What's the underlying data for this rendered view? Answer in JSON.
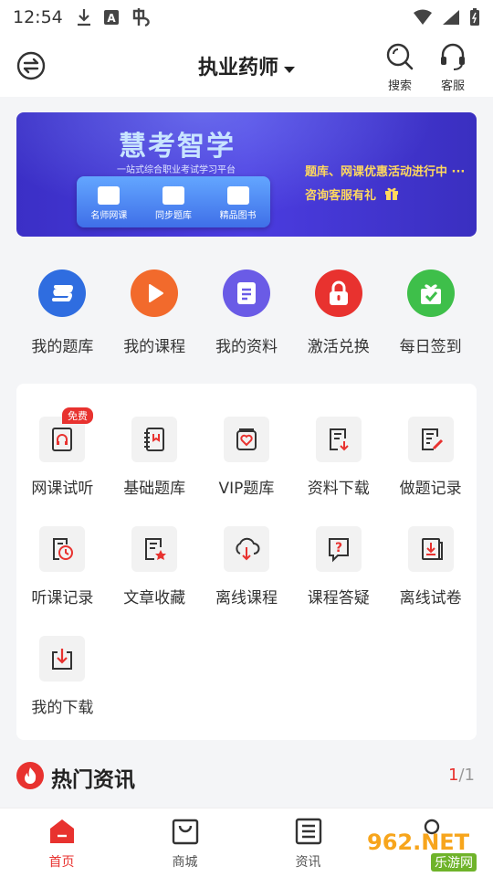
{
  "status_bar": {
    "time": "12:54"
  },
  "header": {
    "title": "执业药师",
    "search_label": "搜索",
    "service_label": "客服"
  },
  "banner": {
    "brand": "慧考智学",
    "slogan": "一站式综合职业考试学习平台",
    "panel_items": [
      "名师网课",
      "同步题库",
      "精品图书"
    ],
    "promo_line1": "题库、网课优惠活动进行中 ···",
    "promo_line2": "咨询客服有礼"
  },
  "quick_actions": [
    {
      "label": "我的题库",
      "icon": "question-bank-icon",
      "color": "#2f6de0"
    },
    {
      "label": "我的课程",
      "icon": "play-icon",
      "color": "#f26a2c"
    },
    {
      "label": "我的资料",
      "icon": "document-icon",
      "color": "#6a5be6"
    },
    {
      "label": "激活兑换",
      "icon": "lock-icon",
      "color": "#e8322f"
    },
    {
      "label": "每日签到",
      "icon": "gift-icon",
      "color": "#3ebf4a"
    }
  ],
  "grid": {
    "items": [
      {
        "label": "网课试听",
        "icon": "headphones-book-icon",
        "badge": "免费"
      },
      {
        "label": "基础题库",
        "icon": "notebook-icon"
      },
      {
        "label": "VIP题库",
        "icon": "vip-folder-icon"
      },
      {
        "label": "资料下载",
        "icon": "file-download-icon"
      },
      {
        "label": "做题记录",
        "icon": "edit-record-icon"
      },
      {
        "label": "听课记录",
        "icon": "clock-record-icon"
      },
      {
        "label": "文章收藏",
        "icon": "star-article-icon"
      },
      {
        "label": "离线课程",
        "icon": "cloud-download-icon"
      },
      {
        "label": "课程答疑",
        "icon": "question-bubble-icon"
      },
      {
        "label": "离线试卷",
        "icon": "offline-paper-icon"
      },
      {
        "label": "我的下载",
        "icon": "download-box-icon"
      }
    ]
  },
  "hot_news": {
    "title": "热门资讯",
    "page_current": "1",
    "page_total": "/1"
  },
  "tabbar": [
    {
      "label": "首页",
      "active": true
    },
    {
      "label": "商城",
      "active": false
    },
    {
      "label": "资讯",
      "active": false
    },
    {
      "label": "",
      "active": false
    }
  ],
  "watermark": {
    "text1": "962.NET",
    "text2": "乐游网"
  },
  "colors": {
    "accent": "#e8322f",
    "banner": "#4b3ce0",
    "promo": "#ffd85e"
  }
}
